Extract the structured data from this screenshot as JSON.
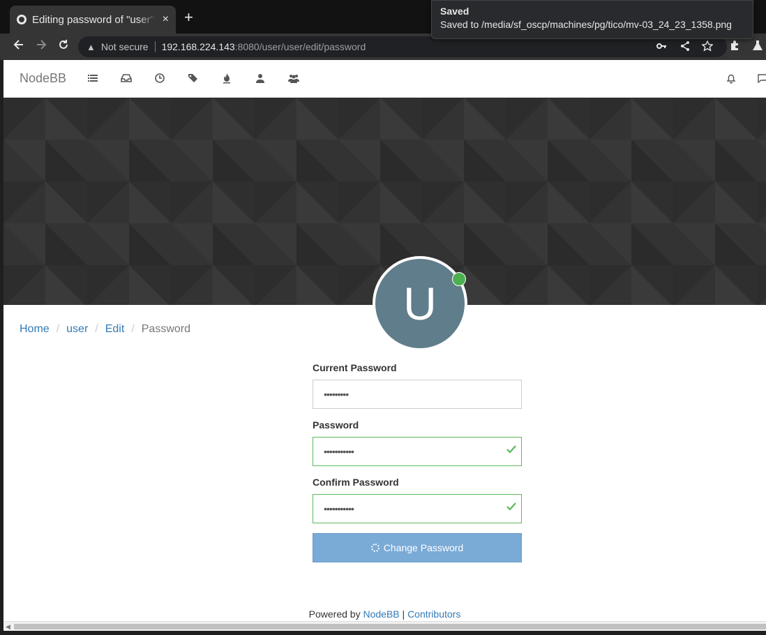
{
  "browser": {
    "tab_title": "Editing password of \"user\"",
    "new_tab": "+",
    "close_tab": "×",
    "not_secure": "Not secure",
    "url_host": "192.168.224.143",
    "url_rest": ":8080/user/user/edit/password"
  },
  "toast": {
    "title": "Saved",
    "message": "Saved to /media/sf_oscp/machines/pg/tico/mv-03_24_23_1358.png"
  },
  "nav": {
    "brand": "NodeBB",
    "icons": [
      "list-icon",
      "inbox-icon",
      "clock-icon",
      "tags-icon",
      "fire-icon",
      "user-icon",
      "users-icon",
      "bell-icon",
      "chat-icon"
    ]
  },
  "profile": {
    "avatar_letter": "U",
    "avatar_color": "#607d8b",
    "status_color": "#4caf50"
  },
  "breadcrumb": {
    "home": "Home",
    "user": "user",
    "edit": "Edit",
    "current": "Password"
  },
  "form": {
    "current_password_label": "Current Password",
    "current_password_value": "•••••••••",
    "password_label": "Password",
    "password_value": "•••••••••••",
    "confirm_password_label": "Confirm Password",
    "confirm_password_value": "•••••••••••",
    "submit_label": "Change Password"
  },
  "footer": {
    "powered_by": "Powered by",
    "nodebb_link": "NodeBB",
    "divider": "|",
    "contributors_link": "Contributors"
  }
}
